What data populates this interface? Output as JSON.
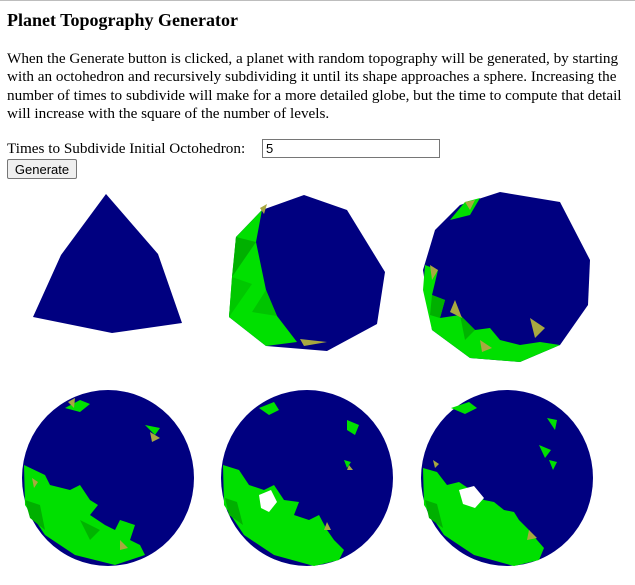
{
  "page": {
    "title": "Planet Topography Generator",
    "description": "When the Generate button is clicked, a planet with random topography will be generated, by starting with an octohedron and recursively subdividing it until its shape approaches a sphere. Increasing the number of times to subdivide will make for a more detailed globe, but the time to compute that detail will increase with the square of the number of levels."
  },
  "form": {
    "subdivide_label": "Times to Subdivide Initial Octohedron:",
    "subdivide_value": "5",
    "generate_label": "Generate"
  },
  "colors": {
    "ocean": "#000080",
    "land": "#00e000",
    "land_shade": "#00b000",
    "mountain": "#a8a840",
    "snow": "#ffffff"
  },
  "planets": [
    {
      "level": 0
    },
    {
      "level": 1
    },
    {
      "level": 2
    },
    {
      "level": 3
    },
    {
      "level": 4
    },
    {
      "level": 5
    }
  ]
}
